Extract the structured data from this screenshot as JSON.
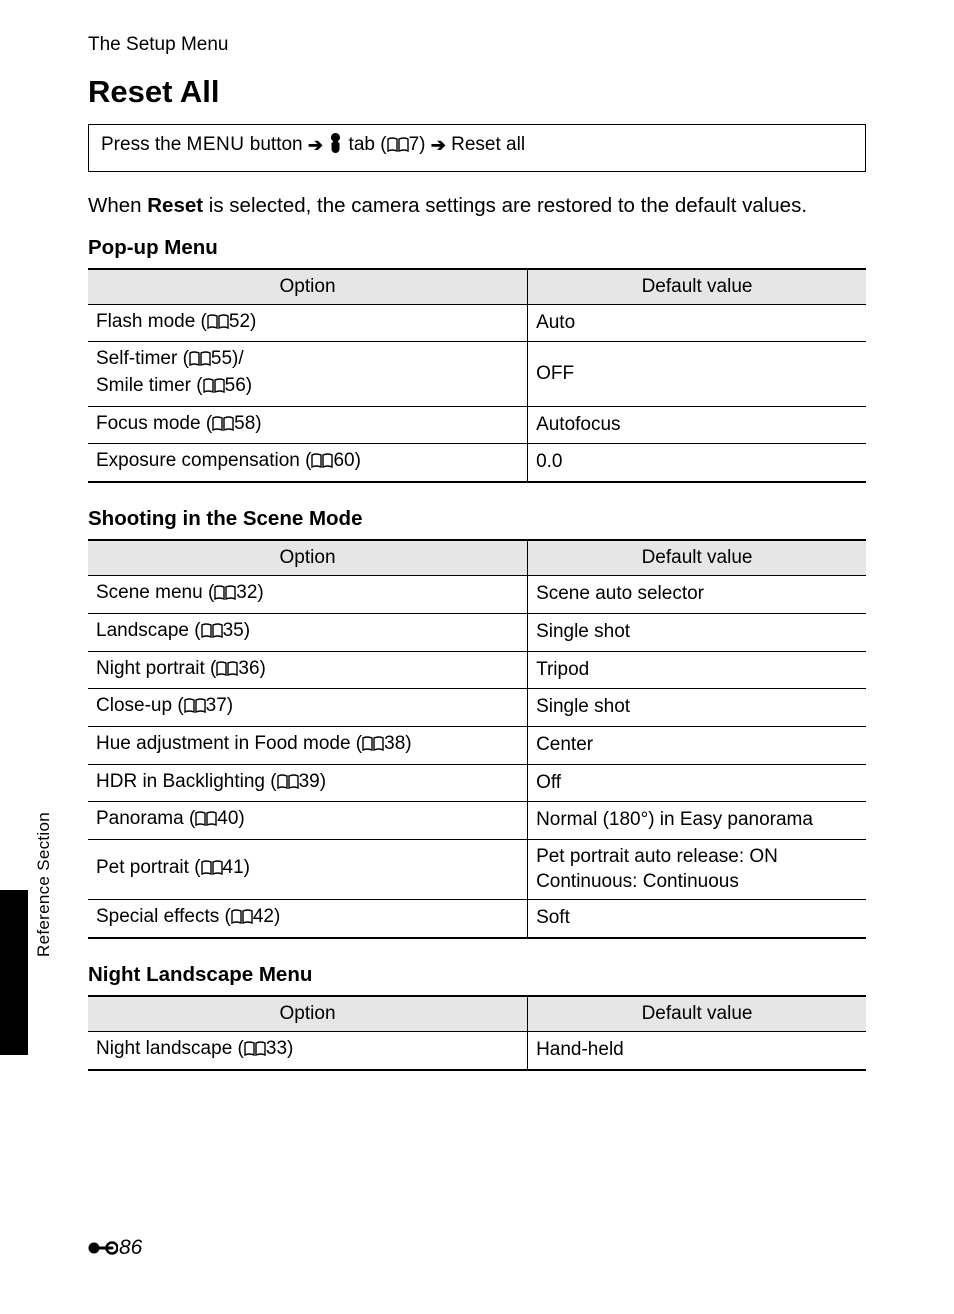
{
  "header_label": "The Setup Menu",
  "side_label": "Reference Section",
  "title": "Reset All",
  "path": {
    "prefix": "Press the ",
    "menu_word": "MENU",
    "mid1": " button ",
    "tab_word": " tab (",
    "tab_ref": "7",
    "mid2": ") ",
    "end": " Reset all"
  },
  "intro": {
    "before": "When ",
    "bold": "Reset",
    "after": " is selected, the camera settings are restored to the default values."
  },
  "table_headers": {
    "option": "Option",
    "default": "Default value"
  },
  "sections": [
    {
      "heading": "Pop-up Menu",
      "rows": [
        {
          "opt_pre": "Flash mode (",
          "ref": "52",
          "opt_post": ")",
          "val": "Auto"
        },
        {
          "opt_pre": "Self-timer (",
          "ref": "55",
          "opt_post": ")/",
          "line2_pre": "Smile timer (",
          "line2_ref": "56",
          "line2_post": ")",
          "val": "OFF"
        },
        {
          "opt_pre": "Focus mode (",
          "ref": "58",
          "opt_post": ")",
          "val": "Autofocus"
        },
        {
          "opt_pre": "Exposure compensation (",
          "ref": "60",
          "opt_post": ")",
          "val": "0.0"
        }
      ]
    },
    {
      "heading": "Shooting in the Scene Mode",
      "rows": [
        {
          "opt_pre": "Scene menu (",
          "ref": "32",
          "opt_post": ")",
          "val": "Scene auto selector"
        },
        {
          "opt_pre": "Landscape (",
          "ref": "35",
          "opt_post": ")",
          "val": "Single shot"
        },
        {
          "opt_pre": "Night portrait (",
          "ref": "36",
          "opt_post": ")",
          "val": "Tripod"
        },
        {
          "opt_pre": "Close-up (",
          "ref": "37",
          "opt_post": ")",
          "val": "Single shot"
        },
        {
          "opt_pre": "Hue adjustment in Food mode (",
          "ref": "38",
          "opt_post": ")",
          "val": "Center"
        },
        {
          "opt_pre": "HDR in Backlighting (",
          "ref": "39",
          "opt_post": ")",
          "val": "Off"
        },
        {
          "opt_pre": "Panorama (",
          "ref": "40",
          "opt_post": ")",
          "val": "Normal (180°) in Easy panorama"
        },
        {
          "opt_pre": "Pet portrait (",
          "ref": "41",
          "opt_post": ")",
          "val": "Pet portrait auto release: ON\nContinuous: Continuous"
        },
        {
          "opt_pre": "Special effects (",
          "ref": "42",
          "opt_post": ")",
          "val": "Soft"
        }
      ]
    },
    {
      "heading": "Night Landscape Menu",
      "rows": [
        {
          "opt_pre": "Night landscape (",
          "ref": "33",
          "opt_post": ")",
          "val": "Hand-held"
        }
      ]
    }
  ],
  "page_number": "86"
}
